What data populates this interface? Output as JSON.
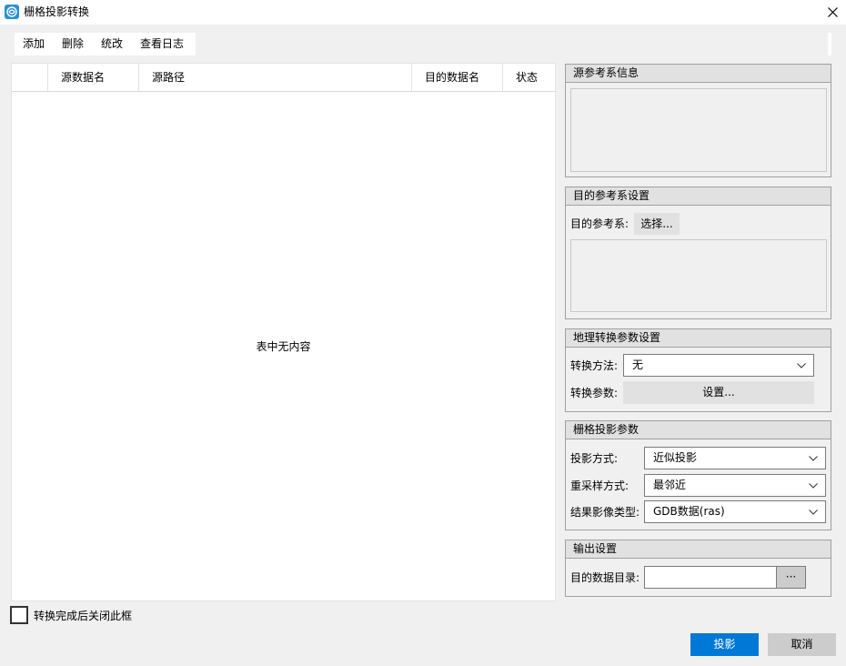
{
  "window": {
    "title": "栅格投影转换"
  },
  "toolbar": {
    "add": "添加",
    "delete": "删除",
    "batch_edit": "统改",
    "view_log": "查看日志"
  },
  "table": {
    "columns": [
      "源数据名",
      "源路径",
      "目的数据名",
      "状态"
    ],
    "empty_text": "表中无内容"
  },
  "source_ref": {
    "title": "源参考系信息"
  },
  "target_ref": {
    "title": "目的参考系设置",
    "label": "目的参考系:",
    "select_button": "选择..."
  },
  "geo_transform": {
    "title": "地理转换参数设置",
    "method_label": "转换方法:",
    "method_value": "无",
    "params_label": "转换参数:",
    "params_button": "设置..."
  },
  "raster_proj": {
    "title": "栅格投影参数",
    "projection_label": "投影方式:",
    "projection_value": "近似投影",
    "resample_label": "重采样方式:",
    "resample_value": "最邻近",
    "result_type_label": "结果影像类型:",
    "result_type_value": "GDB数据(ras)"
  },
  "output": {
    "title": "输出设置",
    "dir_label": "目的数据目录:",
    "dir_value": "",
    "browse_button": "···"
  },
  "footer": {
    "close_after_label": "转换完成后关闭此框",
    "project_button": "投影",
    "cancel_button": "取消"
  },
  "colors": {
    "primary": "#0078d7",
    "cancel": "#cccccc",
    "app_icon": "#2a8fd6"
  }
}
